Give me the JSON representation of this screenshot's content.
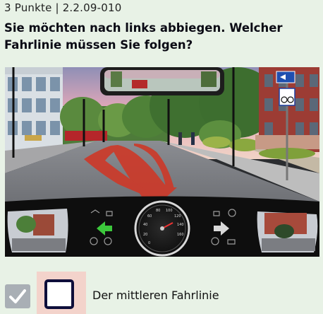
{
  "header": {
    "meta": "3 Punkte | 2.2.09-010",
    "question": "Sie möchten nach links abbiegen. Welcher Fahrlinie müssen Sie folgen?"
  },
  "scene": {
    "description_icons": [
      "rear-mirror-icon",
      "side-mirror-left-icon",
      "side-mirror-right-icon",
      "speedometer-icon",
      "left-turn-signal-icon",
      "right-turn-signal-icon",
      "bike-lane-sign-icon"
    ],
    "colors": {
      "route": "#cc3a2a",
      "turn_signal_active": "#3cc83c",
      "sky": "#dfa7b6"
    }
  },
  "answers": [
    {
      "label": "Der mittleren Fahrlinie",
      "checked": false
    }
  ]
}
